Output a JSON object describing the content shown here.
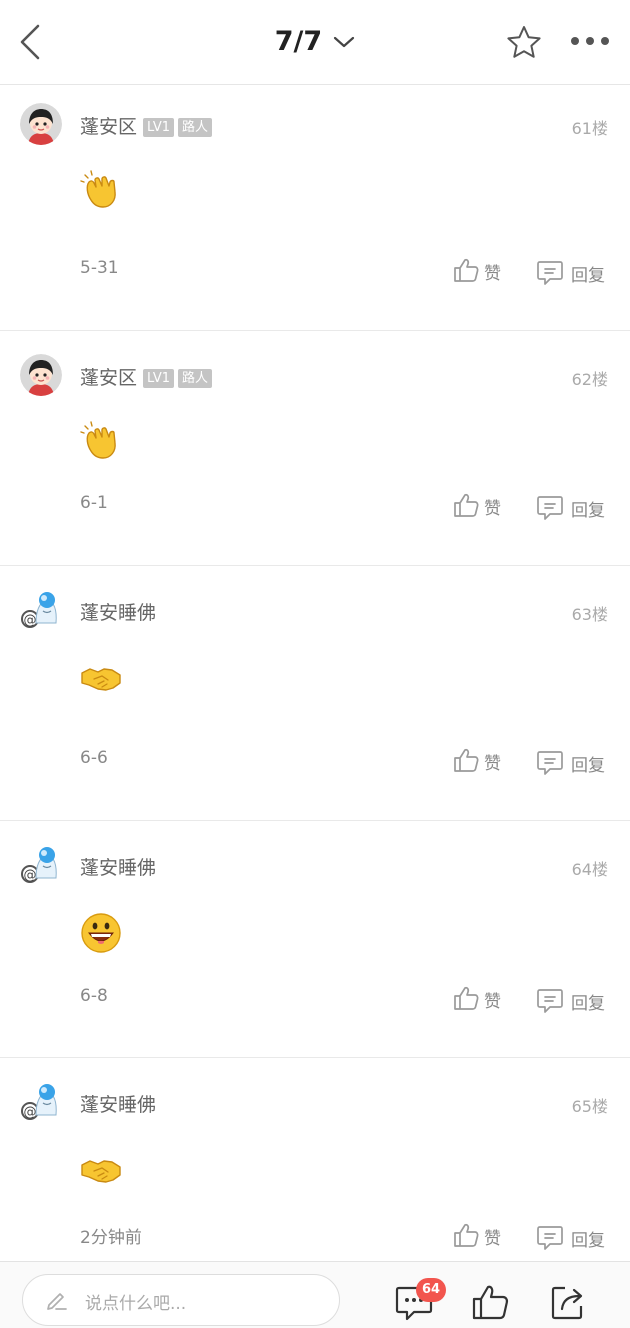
{
  "header": {
    "page_indicator": "7/7",
    "icons": {
      "back": "back-arrow-icon",
      "dropdown": "chevron-down-icon",
      "favorite": "star-icon",
      "more": "more-dots-icon"
    }
  },
  "posts": [
    {
      "username": "蓬安区",
      "level": "LV1",
      "title": "路人",
      "floor": "61楼",
      "emoji": "clap-emoji",
      "date": "5-31",
      "like_label": "赞",
      "reply_label": "回复"
    },
    {
      "username": "蓬安区",
      "level": "LV1",
      "title": "路人",
      "floor": "62楼",
      "emoji": "clap-emoji",
      "date": "6-1",
      "like_label": "赞",
      "reply_label": "回复"
    },
    {
      "username": "蓬安睡佛",
      "floor": "63楼",
      "emoji": "handshake-emoji",
      "date": "6-6",
      "like_label": "赞",
      "reply_label": "回复"
    },
    {
      "username": "蓬安睡佛",
      "floor": "64楼",
      "emoji": "grin-emoji",
      "date": "6-8",
      "like_label": "赞",
      "reply_label": "回复"
    },
    {
      "username": "蓬安睡佛",
      "floor": "65楼",
      "emoji": "handshake-emoji",
      "date": "2分钟前",
      "like_label": "赞",
      "reply_label": "回复"
    }
  ],
  "bottom_bar": {
    "input_placeholder": "说点什么吧...",
    "comment_count": "64",
    "icons": {
      "edit": "pencil-icon",
      "comment": "comment-icon",
      "like": "thumbs-up-icon",
      "share": "share-icon"
    }
  },
  "colors": {
    "badge_red": "#f2554e",
    "level_badge": "#c4c4c4",
    "separator": "#e9e9e9"
  }
}
